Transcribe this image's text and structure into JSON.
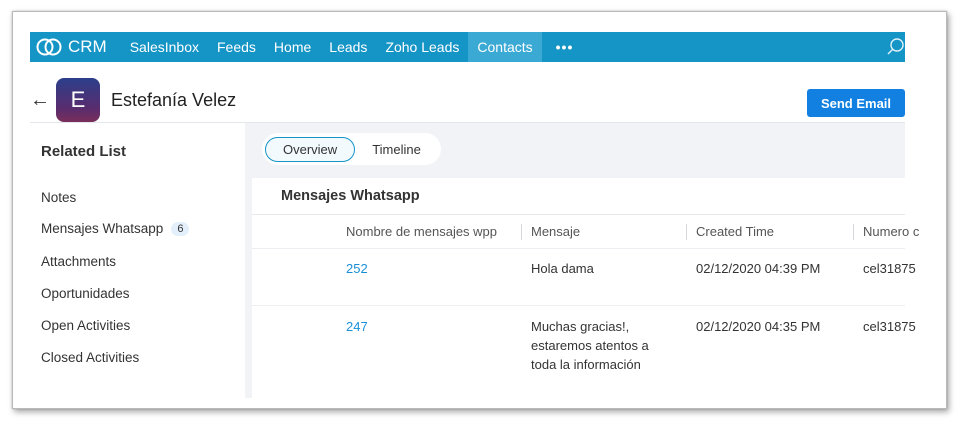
{
  "nav": {
    "brand": "CRM",
    "items": [
      "SalesInbox",
      "Feeds",
      "Home",
      "Leads",
      "Zoho Leads",
      "Contacts"
    ],
    "active_index": 5,
    "more": "•••"
  },
  "header": {
    "avatar_letter": "E",
    "contact_name": "Estefanía Velez",
    "send_email_label": "Send Email"
  },
  "sidebar": {
    "title": "Related List",
    "items": [
      {
        "label": "Notes"
      },
      {
        "label": "Mensajes Whatsapp",
        "badge": "6"
      },
      {
        "label": "Attachments"
      },
      {
        "label": "Oportunidades"
      },
      {
        "label": "Open Activities"
      },
      {
        "label": "Closed Activities"
      }
    ]
  },
  "tabs": [
    "Overview",
    "Timeline"
  ],
  "panel": {
    "title": "Mensajes Whatsapp",
    "columns": [
      "Nombre de mensajes wpp",
      "Mensaje",
      "Created Time",
      "Numero c"
    ],
    "rows": [
      {
        "name": "252",
        "mensaje": "Hola dama",
        "created": "02/12/2020 04:39 PM",
        "numero": "cel31875"
      },
      {
        "name": "247",
        "mensaje": "Muchas gracias!, estaremos atentos a toda la información",
        "created": "02/12/2020 04:35 PM",
        "numero": "cel31875"
      }
    ]
  },
  "colors": {
    "nav_bg": "#1594c6",
    "nav_active": "#3aa9d4",
    "send_button": "#1180e0",
    "link": "#1a8fd8"
  }
}
